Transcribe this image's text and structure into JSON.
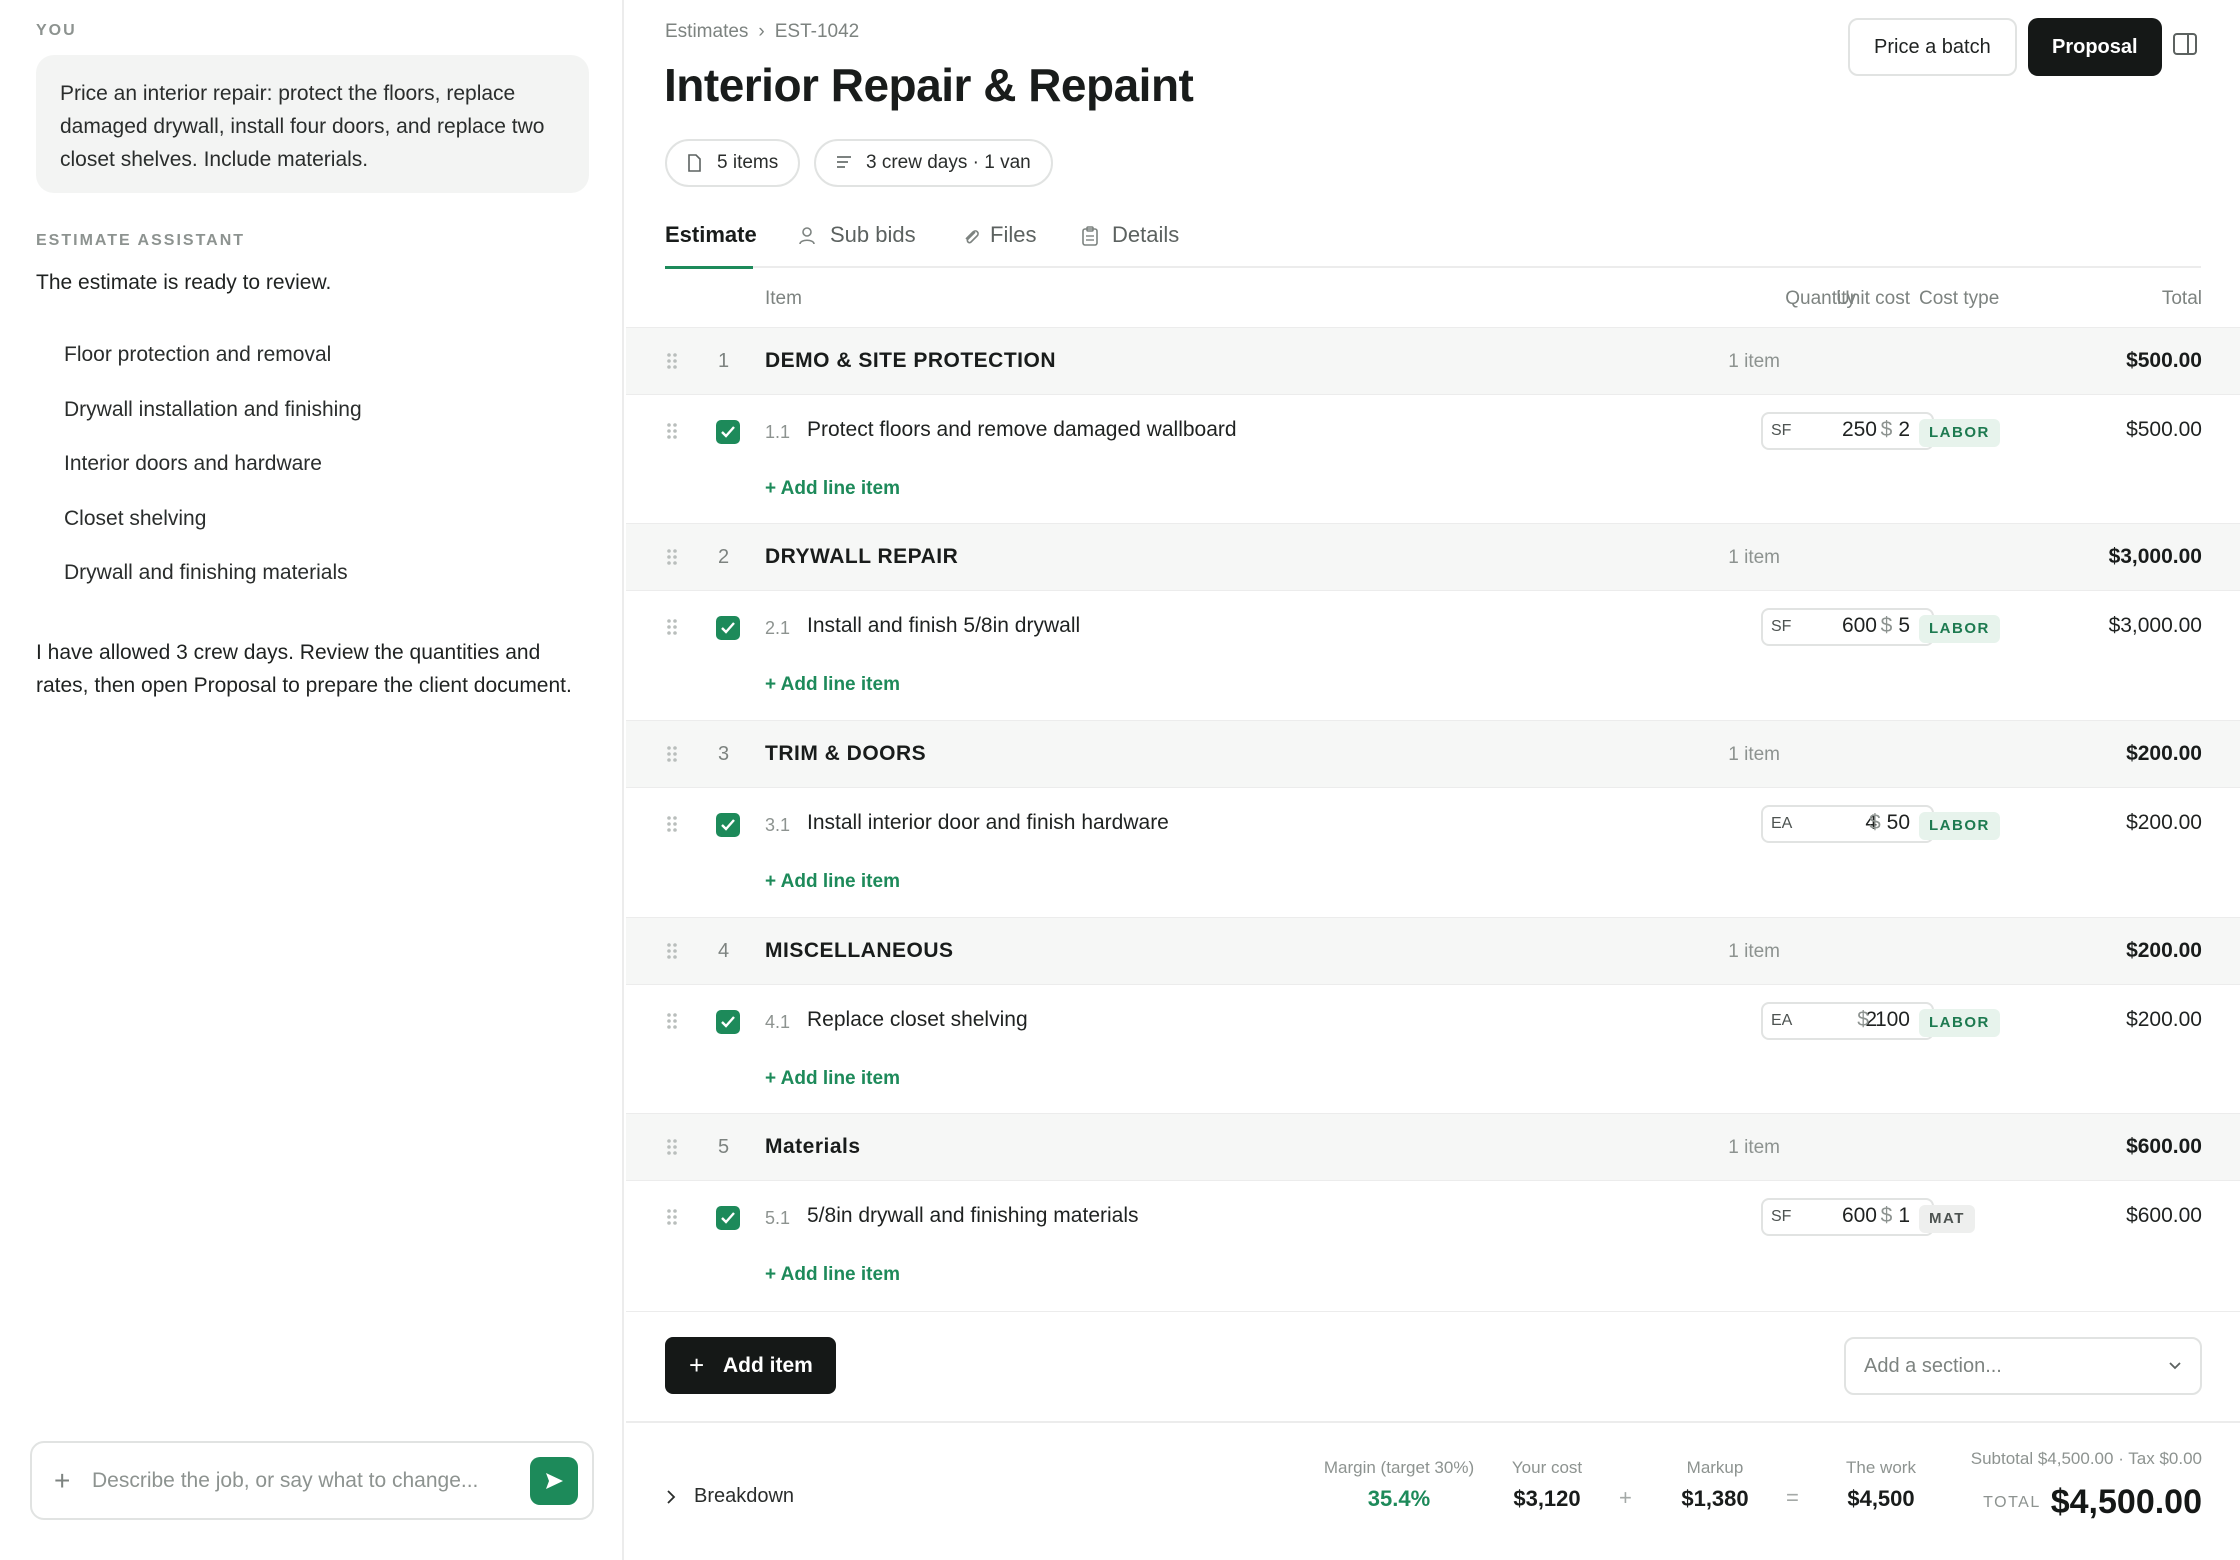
{
  "chat": {
    "user_label": "YOU",
    "user_message": "Price an interior repair: protect the floors, replace damaged drywall, install four doors, and replace two closet shelves. Include materials.",
    "assistant_label": "ESTIMATE ASSISTANT",
    "assistant_intro": "The estimate is ready to review.",
    "steps": [
      "Floor protection and removal",
      "Drywall installation and finishing",
      "Interior doors and hardware",
      "Closet shelving",
      "Drywall and finishing materials"
    ],
    "assistant_outro": "I have allowed 3 crew days. Review the quantities and rates, then open Proposal to prepare the client document.",
    "composer_placeholder": "Describe the job, or say what to change..."
  },
  "header": {
    "breadcrumb": [
      "Estimates",
      "EST-1042"
    ],
    "breadcrumb_sep": "›",
    "title": "Interior Repair & Repaint",
    "price_batch_label": "Price a batch",
    "proposal_label": "Proposal",
    "chips": [
      "5 items",
      "3 crew days · 1 van"
    ]
  },
  "tabs": [
    "Estimate",
    "Sub bids",
    "Files",
    "Details"
  ],
  "columns": {
    "item": "Item",
    "quantity": "Quantity",
    "unit_cost": "Unit cost",
    "cost_type": "Cost type",
    "total": "Total"
  },
  "sections": [
    {
      "num": "1",
      "name": "DEMO & SITE PROTECTION",
      "count": "1 item",
      "total": "$500.00",
      "line": {
        "code": "1.1",
        "desc": "Protect floors and remove damaged wallboard",
        "qty": "250",
        "unit": "SF",
        "cost": "2",
        "type": "LABOR",
        "total": "$500.00"
      }
    },
    {
      "num": "2",
      "name": "DRYWALL REPAIR",
      "count": "1 item",
      "total": "$3,000.00",
      "line": {
        "code": "2.1",
        "desc": "Install and finish 5/8in drywall",
        "qty": "600",
        "unit": "SF",
        "cost": "5",
        "type": "LABOR",
        "total": "$3,000.00"
      }
    },
    {
      "num": "3",
      "name": "TRIM & DOORS",
      "count": "1 item",
      "total": "$200.00",
      "line": {
        "code": "3.1",
        "desc": "Install interior door and finish hardware",
        "qty": "4",
        "unit": "EA",
        "cost": "50",
        "type": "LABOR",
        "total": "$200.00"
      }
    },
    {
      "num": "4",
      "name": "MISCELLANEOUS",
      "count": "1 item",
      "total": "$200.00",
      "line": {
        "code": "4.1",
        "desc": "Replace closet shelving",
        "qty": "2",
        "unit": "EA",
        "cost": "100",
        "type": "LABOR",
        "total": "$200.00"
      }
    },
    {
      "num": "5",
      "name": "Materials",
      "count": "1 item",
      "total": "$600.00",
      "line": {
        "code": "5.1",
        "desc": "5/8in drywall and finishing materials",
        "qty": "600",
        "unit": "SF",
        "cost": "1",
        "type": "MAT",
        "total": "$600.00"
      }
    }
  ],
  "currency_symbol": "$",
  "add_line_label": "+ Add line item",
  "add_item_label": "Add item",
  "add_section_placeholder": "Add a section...",
  "footer": {
    "breakdown_label": "Breakdown",
    "margin_label": "Margin (target 30%)",
    "margin_value": "35.4%",
    "cost_label": "Your cost",
    "cost_value": "$3,120",
    "op_plus": "+",
    "markup_label": "Markup",
    "markup_value": "$1,380",
    "op_equals": "=",
    "work_label": "The work",
    "work_value": "$4,500",
    "subtotal_line": "Subtotal $4,500.00 · Tax $0.00",
    "total_label": "TOTAL",
    "total_value": "$4,500.00"
  },
  "colors": {
    "accent": "#1d8a5a",
    "dark": "#151817",
    "labor_bg": "#e7f3ec"
  }
}
